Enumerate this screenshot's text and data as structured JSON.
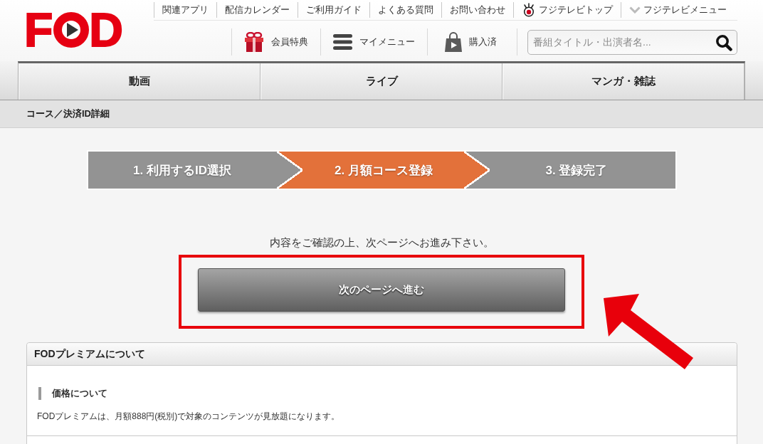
{
  "header": {
    "logo": {
      "left": "F",
      "right": "D"
    },
    "top_links": [
      {
        "label": "関連アプリ",
        "kind": "text"
      },
      {
        "label": "配信カレンダー",
        "kind": "text"
      },
      {
        "label": "ご利用ガイド",
        "kind": "text"
      },
      {
        "label": "よくある質問",
        "kind": "text"
      },
      {
        "label": "お問い合わせ",
        "kind": "text"
      },
      {
        "label": "フジテレビトップ",
        "kind": "eye"
      },
      {
        "label": "フジテレビメニュー",
        "kind": "dropdown"
      }
    ],
    "member_links": [
      {
        "label": "会員特典",
        "kind": "gift"
      },
      {
        "label": "マイメニュー",
        "kind": "menu"
      },
      {
        "label": "購入済",
        "kind": "bag"
      }
    ],
    "search": {
      "placeholder": "番組タイトル・出演者名..."
    }
  },
  "nav_tabs": [
    {
      "label": "動画",
      "selected": false
    },
    {
      "label": "ライブ",
      "selected": false
    },
    {
      "label": "マンガ・雑誌",
      "selected": false
    }
  ],
  "breadcrumb": {
    "label": "コース／決済ID詳細"
  },
  "steps": [
    {
      "label": "1. 利用するID選択",
      "selected": false
    },
    {
      "label": "2. 月額コース登録",
      "selected": true
    },
    {
      "label": "3. 登録完了",
      "selected": false
    }
  ],
  "instruction": "内容をご確認の上、次ページへお進み下さい。",
  "next_button": {
    "label": "次のページへ進む",
    "highlighted": true,
    "arrow_pointer": true
  },
  "panel": {
    "title": "FODプレミアムについて",
    "sections": [
      {
        "heading": "価格について",
        "text": "FODプレミアムは、月額888円(税別)で対象のコンテンツが見放題になります。"
      }
    ]
  }
}
